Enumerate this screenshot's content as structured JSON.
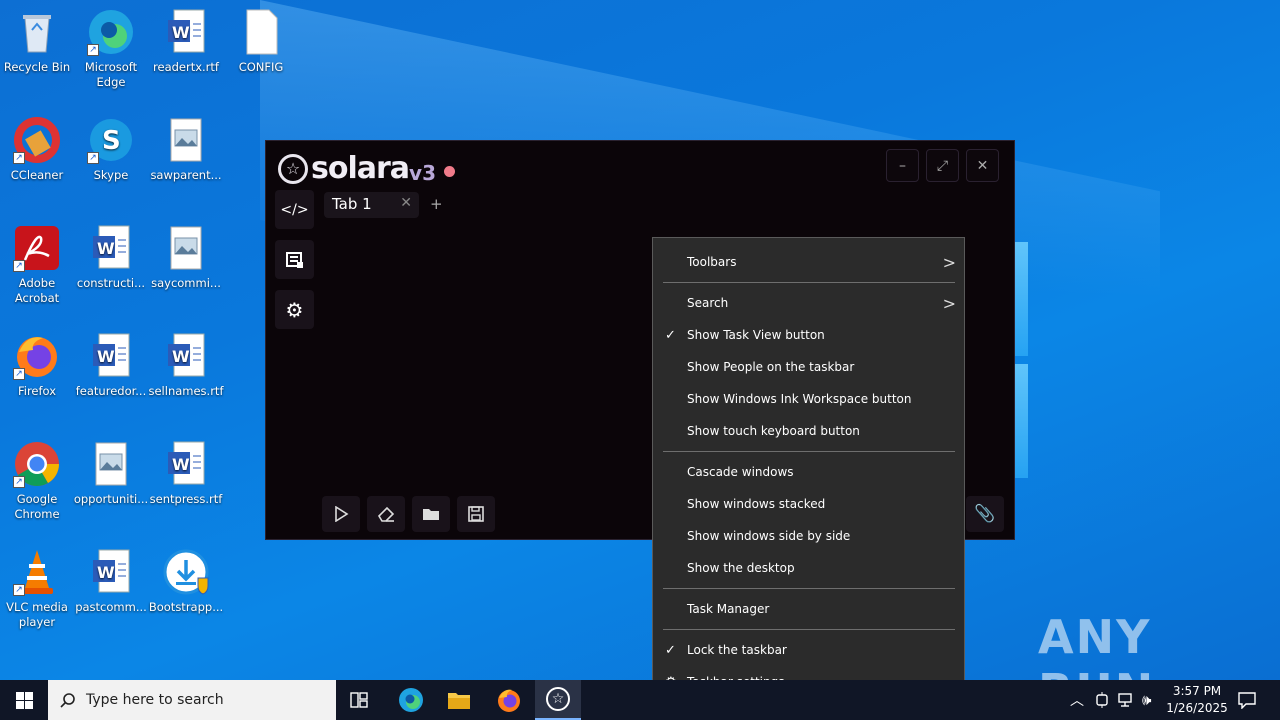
{
  "desktop": {
    "icons": [
      {
        "label": "Recycle Bin"
      },
      {
        "label": "Microsoft Edge"
      },
      {
        "label": "readertx.rtf"
      },
      {
        "label": "CONFIG"
      },
      {
        "label": "CCleaner"
      },
      {
        "label": "Skype"
      },
      {
        "label": "sawparent..."
      },
      {
        "label": "Adobe Acrobat"
      },
      {
        "label": "constructi..."
      },
      {
        "label": "saycommi..."
      },
      {
        "label": "Firefox"
      },
      {
        "label": "featuredor..."
      },
      {
        "label": "sellnames.rtf"
      },
      {
        "label": "Google Chrome"
      },
      {
        "label": "opportuniti..."
      },
      {
        "label": "sentpress.rtf"
      },
      {
        "label": "VLC media player"
      },
      {
        "label": "pastcomm..."
      },
      {
        "label": "Bootstrapp..."
      }
    ]
  },
  "solara": {
    "name": "solara",
    "version": "v3",
    "tab_label": "Tab 1",
    "tab_close": "✕",
    "tab_add": "+",
    "window_buttons": {
      "minimize": "–",
      "maximize": "⤢",
      "close": "✕"
    }
  },
  "context_menu": {
    "items": [
      {
        "label": "Toolbars",
        "checked": false,
        "submenu": true
      },
      {
        "label": "Search",
        "checked": false,
        "submenu": true
      },
      {
        "label": "Show Task View button",
        "checked": true
      },
      {
        "label": "Show People on the taskbar",
        "checked": false
      },
      {
        "label": "Show Windows Ink Workspace button",
        "checked": false
      },
      {
        "label": "Show touch keyboard button",
        "checked": false
      },
      {
        "label": "Cascade windows",
        "checked": false
      },
      {
        "label": "Show windows stacked",
        "checked": false
      },
      {
        "label": "Show windows side by side",
        "checked": false
      },
      {
        "label": "Show the desktop",
        "checked": false
      },
      {
        "label": "Task Manager",
        "checked": false
      },
      {
        "label": "Lock the taskbar",
        "checked": true
      },
      {
        "label": "Taskbar settings",
        "checked": false,
        "icon": "gear-icon"
      }
    ]
  },
  "watermark": "ANY RUN",
  "taskbar": {
    "search_placeholder": "Type here to search",
    "time": "3:57 PM",
    "date": "1/26/2025"
  }
}
